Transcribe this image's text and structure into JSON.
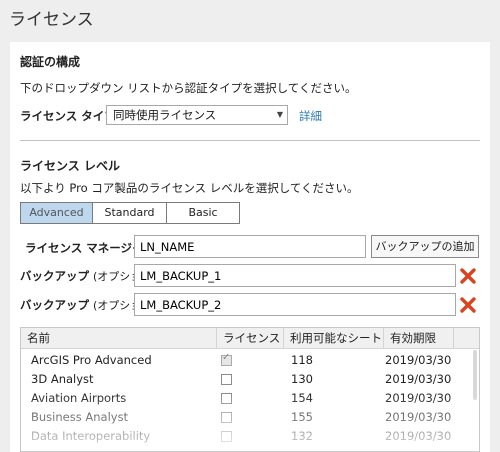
{
  "page_title": "ライセンス",
  "config": {
    "heading": "認証の構成",
    "description": "下のドロップダウン リストから認証タイプを選択してください。",
    "license_type_label": "ライセンス タイプ",
    "license_type_value": "同時使用ライセンス",
    "details_link": "詳細"
  },
  "level": {
    "heading": "ライセンス レベル",
    "description": "以下より Pro コア製品のライセンス レベルを選択してください。",
    "options": [
      "Advanced",
      "Standard",
      "Basic"
    ],
    "selected": "Advanced"
  },
  "manager": {
    "label": "ライセンス マネージャー",
    "value": "LN_NAME",
    "add_backup_button": "バックアップの追加"
  },
  "backups": [
    {
      "label": "バックアップ",
      "label_suffix": "(オプション)",
      "value": "LM_BACKUP_1"
    },
    {
      "label": "バックアップ",
      "label_suffix": "(オプション)",
      "value": "LM_BACKUP_2"
    }
  ],
  "table": {
    "columns": [
      "名前",
      "ライセンス",
      "利用可能なシート",
      "有効期限"
    ],
    "rows": [
      {
        "name": "ArcGIS Pro  Advanced",
        "licensed": true,
        "seats": "118",
        "expiry": "2019/03/30"
      },
      {
        "name": "3D Analyst",
        "licensed": false,
        "seats": "130",
        "expiry": "2019/03/30"
      },
      {
        "name": "Aviation Airports",
        "licensed": false,
        "seats": "154",
        "expiry": "2019/03/30"
      },
      {
        "name": "Business Analyst",
        "licensed": false,
        "seats": "155",
        "expiry": "2019/03/30"
      },
      {
        "name": "Data Interoperability",
        "licensed": false,
        "seats": "132",
        "expiry": "2019/03/30"
      }
    ]
  },
  "colors": {
    "accent": "#bcd7ee",
    "link": "#2a7ab8",
    "delete_icon": "#d9441f"
  }
}
